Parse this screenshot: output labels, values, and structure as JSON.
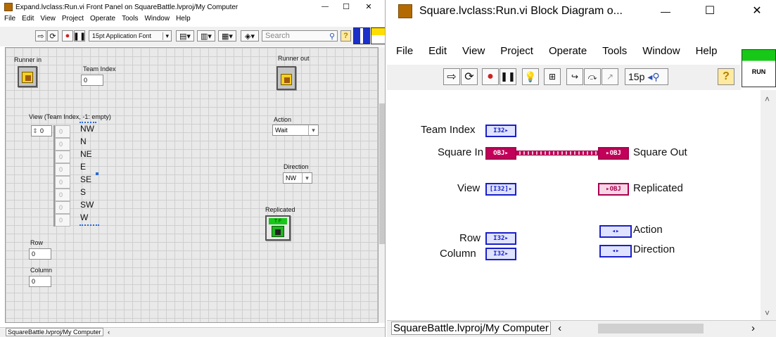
{
  "front_panel": {
    "title": "Expand.lvclass:Run.vi Front Panel on SquareBattle.lvproj/My Computer",
    "menu": [
      "File",
      "Edit",
      "View",
      "Project",
      "Operate",
      "Tools",
      "Window",
      "Help"
    ],
    "font_label": "15pt Application Font",
    "search_placeholder": "Search",
    "controls": {
      "runner_in": "Runner in",
      "team_index_label": "Team Index",
      "team_index_value": "0",
      "view_label": "View (Team Index, -1: empty)",
      "view_index": "0",
      "view_items": [
        "NW",
        "N",
        "NE",
        "E",
        "SE",
        "S",
        "SW",
        "W"
      ],
      "view_cell_value": "0",
      "row_label": "Row",
      "row_value": "0",
      "column_label": "Column",
      "column_value": "0",
      "runner_out": "Runner out",
      "action_label": "Action",
      "action_value": "Wait",
      "direction_label": "Direction",
      "direction_value": "NW",
      "replicated_label": "Replicated",
      "replicated_badge": "T F"
    },
    "status_path": "SquareBattle.lvproj/My Computer"
  },
  "block_diagram": {
    "title": "Square.lvclass:Run.vi Block Diagram o...",
    "menu": [
      "File",
      "Edit",
      "View",
      "Project",
      "Operate",
      "Tools",
      "Window",
      "Help"
    ],
    "font_abbrev": "15p",
    "run_badge": "RUN",
    "terminals": {
      "team_index": "Team Index",
      "square_in": "Square In",
      "square_out": "Square Out",
      "view": "View",
      "replicated": "Replicated",
      "row": "Row",
      "column": "Column",
      "action": "Action",
      "direction": "Direction",
      "i32": "I32",
      "obj": "OBJ",
      "enum": "◂▸"
    },
    "status_path": "SquareBattle.lvproj/My Computer"
  },
  "colors": {
    "i32_blue": "#1a20c8",
    "obj_magenta": "#c2005a",
    "grid": "#e9e9e9",
    "run_green": "#18c818"
  },
  "window_buttons": {
    "minimize": "—",
    "maximize": "☐",
    "close": "✕"
  }
}
